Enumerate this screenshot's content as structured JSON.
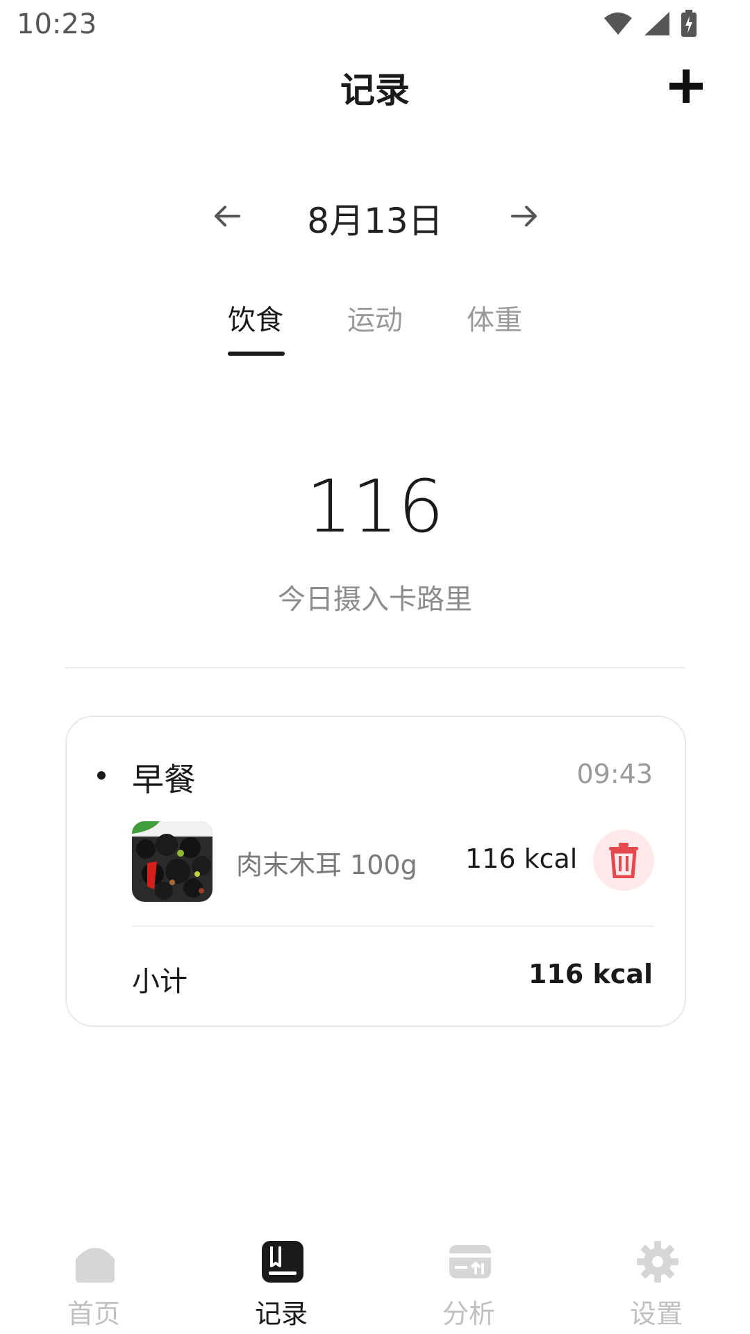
{
  "status_bar": {
    "time": "10:23"
  },
  "header": {
    "title": "记录"
  },
  "date_nav": {
    "date": "8月13日"
  },
  "tabs": [
    {
      "label": "饮食",
      "active": true
    },
    {
      "label": "运动",
      "active": false
    },
    {
      "label": "体重",
      "active": false
    }
  ],
  "summary": {
    "total": "116",
    "caption": "今日摄入卡路里"
  },
  "meal": {
    "name": "早餐",
    "time": "09:43",
    "items": [
      {
        "name": "肉末木耳 100g",
        "kcal": "116 kcal"
      }
    ],
    "subtotal_label": "小计",
    "subtotal_value": "116 kcal"
  },
  "bottom_nav": [
    {
      "label": "首页",
      "icon": "home-icon",
      "active": false
    },
    {
      "label": "记录",
      "icon": "book-icon",
      "active": true
    },
    {
      "label": "分析",
      "icon": "analysis-icon",
      "active": false
    },
    {
      "label": "设置",
      "icon": "gear-icon",
      "active": false
    }
  ],
  "colors": {
    "accent": "#1a1a1a",
    "delete": "#e5484d",
    "delete_bg": "#fde9ea",
    "inactive": "#c0c0c0"
  }
}
